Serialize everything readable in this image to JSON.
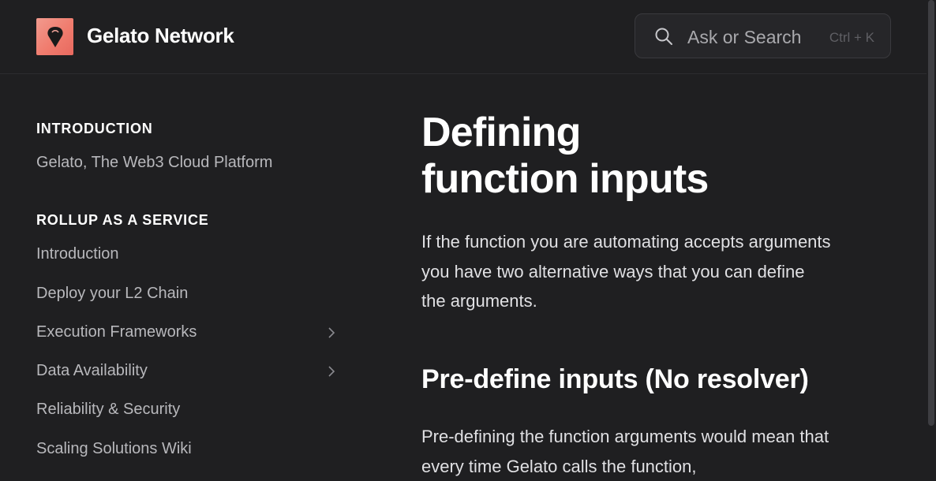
{
  "header": {
    "brand": "Gelato Network",
    "search": {
      "placeholder": "Ask or Search",
      "shortcut": "Ctrl + K"
    }
  },
  "sidebar": {
    "sections": [
      {
        "heading": "INTRODUCTION",
        "items": [
          {
            "label": "Gelato, The Web3 Cloud Platform"
          }
        ]
      },
      {
        "heading": "ROLLUP AS A SERVICE",
        "items": [
          {
            "label": "Introduction"
          },
          {
            "label": "Deploy your L2 Chain"
          },
          {
            "label": "Execution Frameworks",
            "expandable": true
          },
          {
            "label": "Data Availability",
            "expandable": true
          },
          {
            "label": "Reliability & Security"
          },
          {
            "label": "Scaling Solutions Wiki"
          }
        ]
      }
    ]
  },
  "main": {
    "title_line1": "Defining",
    "title_line2": "function inputs",
    "intro": "If the function you are automating accepts arguments you have two alternative ways that you can define the arguments.",
    "subheading": "Pre-define inputs (No resolver)",
    "body": "Pre-defining the function arguments would mean that every time Gelato calls the function,"
  },
  "icons": {
    "logo": "gelato-logo-icon",
    "search": "search-icon",
    "chevron": "chevron-right-icon"
  },
  "colors": {
    "background": "#1f1f21",
    "logo_accent": "#f07c6e",
    "text_primary": "#ffffff",
    "text_secondary": "#b8b8bc"
  }
}
